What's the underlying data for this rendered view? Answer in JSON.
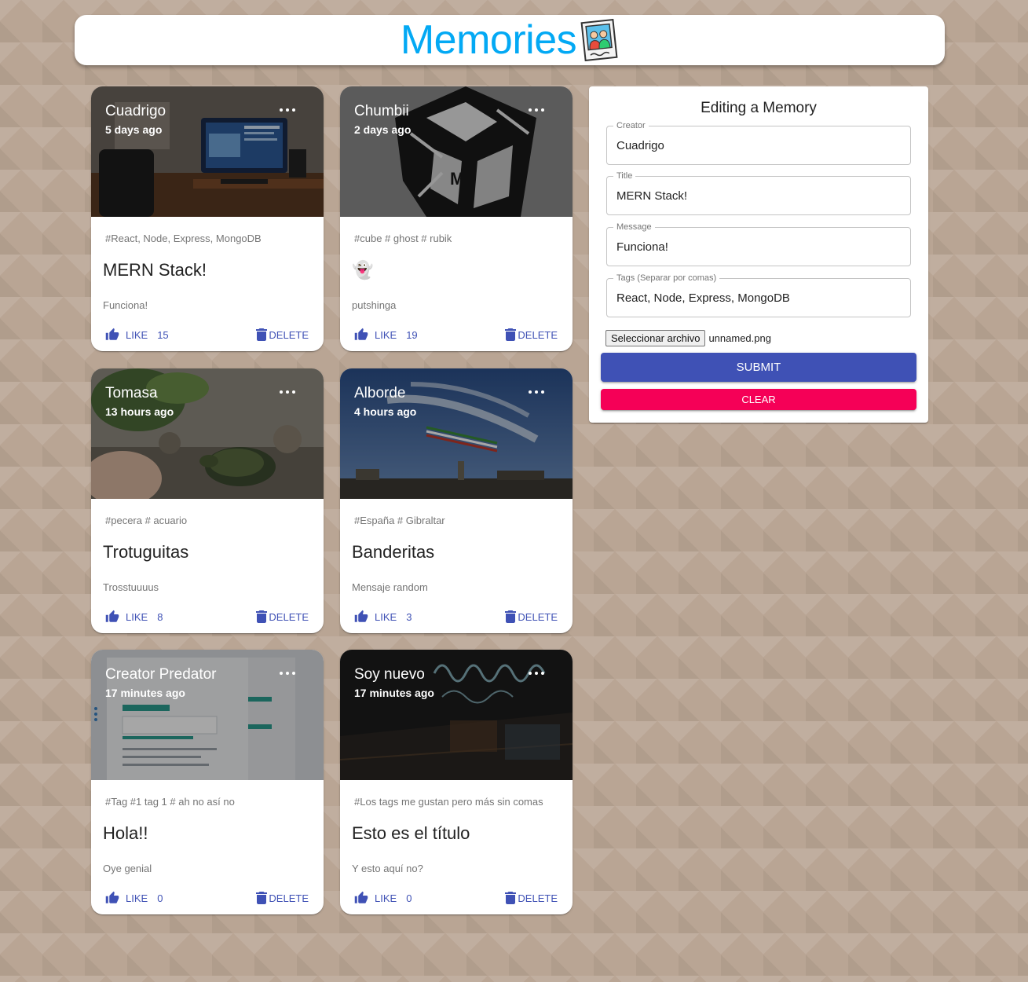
{
  "app": {
    "title": "Memories",
    "logo_icon": "photo-people-icon",
    "title_color": "#03a9f4"
  },
  "posts": [
    {
      "creator": "Cuadrigo",
      "time": "5 days ago",
      "tags": "#React, Node, Express, MongoDB",
      "title": "MERN Stack!",
      "message": "Funciona!",
      "like_label": "LIKE",
      "like_count": "15",
      "delete_label": "DELETE",
      "image": "desk-setup-photo"
    },
    {
      "creator": "Chumbii",
      "time": "2 days ago",
      "tags": "#cube # ghost # rubik",
      "title": "👻",
      "message": "putshinga",
      "like_label": "LIKE",
      "like_count": "19",
      "delete_label": "DELETE",
      "image": "ghost-cube-photo"
    },
    {
      "creator": "Tomasa",
      "time": "13 hours ago",
      "tags": "#pecera # acuario",
      "title": "Trotuguitas",
      "message": "Trosstuuuus",
      "like_label": "LIKE",
      "like_count": "8",
      "delete_label": "DELETE",
      "image": "turtle-photo"
    },
    {
      "creator": "Alborde",
      "time": "4 hours ago",
      "tags": "#España # Gibraltar",
      "title": "Banderitas",
      "message": "Mensaje random",
      "like_label": "LIKE",
      "like_count": "3",
      "delete_label": "DELETE",
      "image": "airshow-sky-photo"
    },
    {
      "creator": "Creator Predator",
      "time": "17 minutes ago",
      "tags": "#Tag #1 tag 1 # ah no así no",
      "title": "Hola!!",
      "message": "Oye genial",
      "like_label": "LIKE",
      "like_count": "0",
      "delete_label": "DELETE",
      "image": "screenshot-photo"
    },
    {
      "creator": "Soy nuevo",
      "time": "17 minutes ago",
      "tags": "#Los tags me gustan pero más sin comas",
      "title": "Esto es el título",
      "message": "Y esto aquí no?",
      "like_label": "LIKE",
      "like_count": "0",
      "delete_label": "DELETE",
      "image": "neon-sign-photo"
    }
  ],
  "form": {
    "heading": "Editing a Memory",
    "creator_label": "Creator",
    "creator_value": "Cuadrigo",
    "title_label": "Title",
    "title_value": "MERN Stack!",
    "message_label": "Message",
    "message_value": "Funciona!",
    "tags_label": "Tags (Separar por comas)",
    "tags_value": "React, Node, Express, MongoDB",
    "file_button": "Seleccionar archivo",
    "file_name": "unnamed.png",
    "submit_label": "SUBMIT",
    "clear_label": "CLEAR",
    "submit_color": "#3f51b5",
    "clear_color": "#f50057"
  }
}
